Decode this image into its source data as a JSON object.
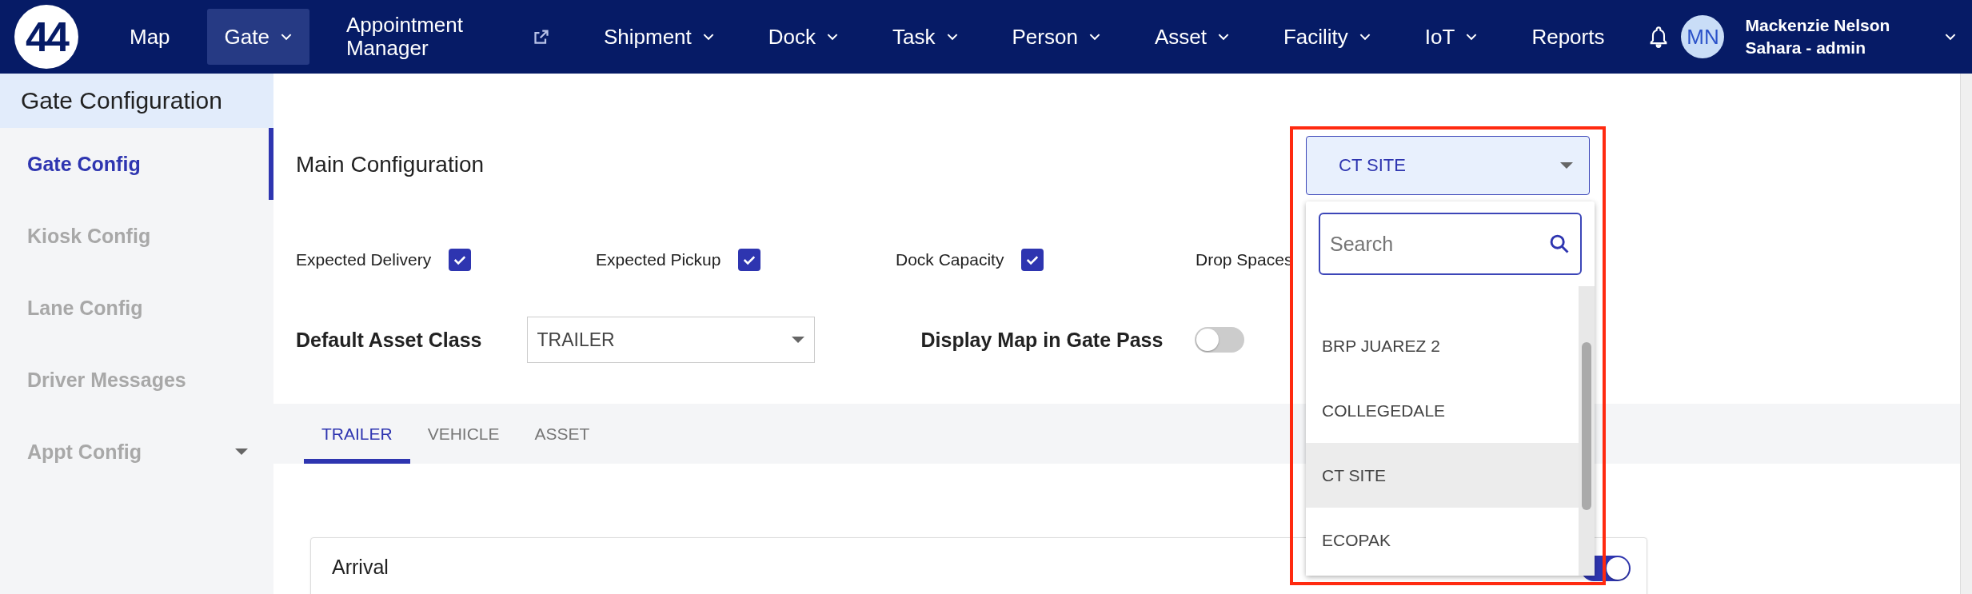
{
  "nav": {
    "logo": "44",
    "items": [
      {
        "label": "Map",
        "kind": "link",
        "selected": false
      },
      {
        "label": "Gate",
        "kind": "menu",
        "selected": true
      },
      {
        "label": "Appointment Manager",
        "kind": "external",
        "selected": false
      },
      {
        "label": "Shipment",
        "kind": "menu",
        "selected": false
      },
      {
        "label": "Dock",
        "kind": "menu",
        "selected": false
      },
      {
        "label": "Task",
        "kind": "menu",
        "selected": false
      },
      {
        "label": "Person",
        "kind": "menu",
        "selected": false
      },
      {
        "label": "Asset",
        "kind": "menu",
        "selected": false
      },
      {
        "label": "Facility",
        "kind": "menu",
        "selected": false
      },
      {
        "label": "IoT",
        "kind": "menu",
        "selected": false
      },
      {
        "label": "Reports",
        "kind": "link",
        "selected": false
      }
    ],
    "user": {
      "initials": "MN",
      "name": "Mackenzie Nelson",
      "role": "Sahara - admin"
    }
  },
  "sidebar": {
    "title": "Gate Configuration",
    "items": [
      {
        "label": "Gate Config",
        "selected": true,
        "expandable": false
      },
      {
        "label": "Kiosk Config",
        "selected": false,
        "expandable": false
      },
      {
        "label": "Lane Config",
        "selected": false,
        "expandable": false
      },
      {
        "label": "Driver Messages",
        "selected": false,
        "expandable": false
      },
      {
        "label": "Appt Config",
        "selected": false,
        "expandable": true
      }
    ]
  },
  "main": {
    "title": "Main Configuration",
    "site_select": {
      "value": "CT SITE",
      "search_placeholder": "Search",
      "options": [
        {
          "label": "BRP JUAREZ 2",
          "selected": false
        },
        {
          "label": "COLLEGEDALE",
          "selected": false
        },
        {
          "label": "CT SITE",
          "selected": true
        },
        {
          "label": "ECOPAK",
          "selected": false
        }
      ]
    },
    "checks": [
      {
        "label": "Expected Delivery",
        "checked": true,
        "kind": "checkbox"
      },
      {
        "label": "Expected Pickup",
        "checked": true,
        "kind": "checkbox"
      },
      {
        "label": "Dock Capacity",
        "checked": true,
        "kind": "checkbox"
      },
      {
        "label": "Drop Spaces",
        "kind": "label"
      }
    ],
    "default_asset_class": {
      "label": "Default Asset Class",
      "value": "TRAILER"
    },
    "display_map": {
      "label": "Display Map in Gate Pass",
      "on": false
    },
    "tabs": [
      {
        "label": "TRAILER",
        "selected": true
      },
      {
        "label": "VEHICLE",
        "selected": false
      },
      {
        "label": "ASSET",
        "selected": false
      }
    ],
    "arrival": {
      "title": "Arrival",
      "on": true
    }
  }
}
